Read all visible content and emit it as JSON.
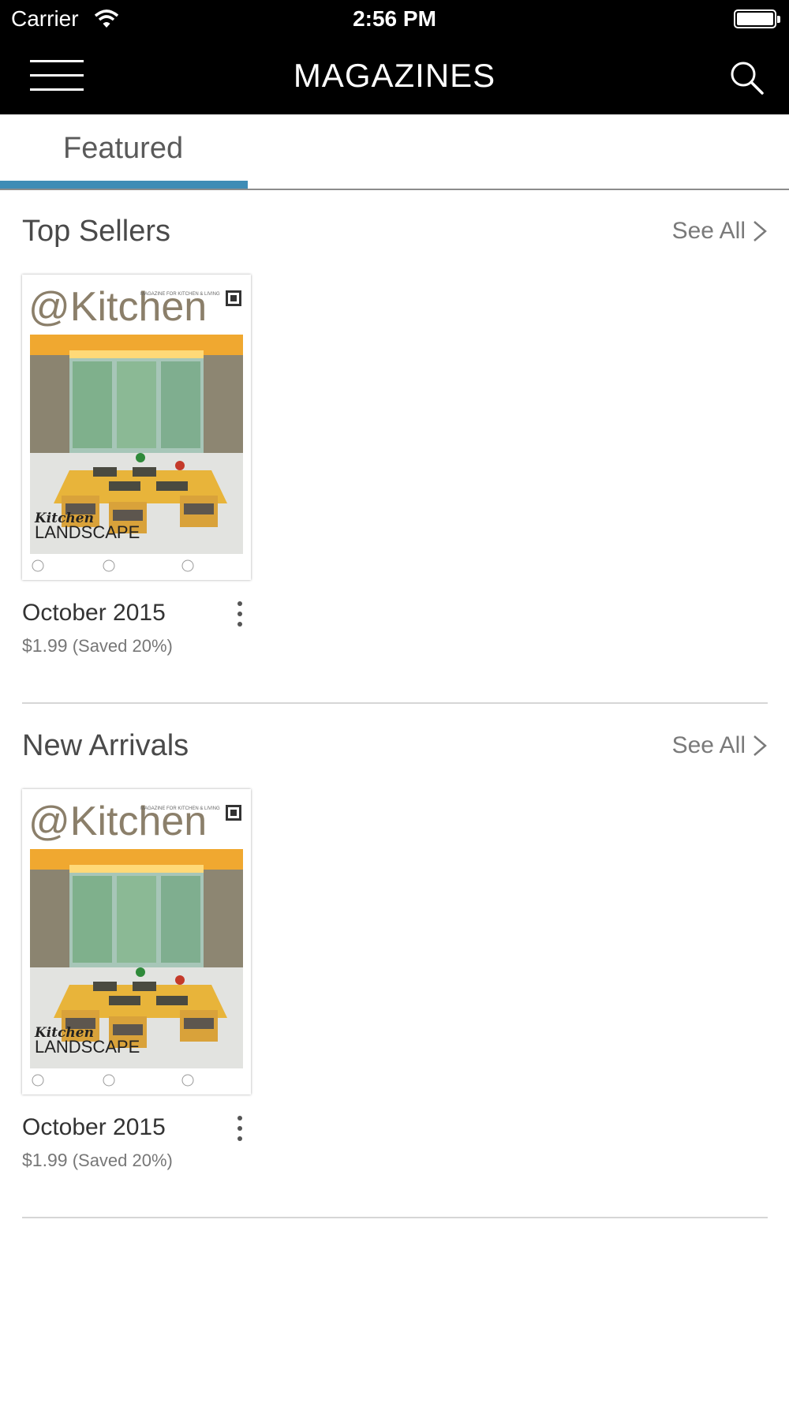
{
  "status_bar": {
    "carrier": "Carrier",
    "time": "2:56 PM"
  },
  "nav": {
    "title": "MAGAZINES"
  },
  "tabs": [
    {
      "label": "Featured",
      "selected": true
    }
  ],
  "colors": {
    "accent": "#3f8cb5",
    "nav_bg": "#000000"
  },
  "sections": [
    {
      "title": "Top Sellers",
      "see_all": "See All",
      "items": [
        {
          "title": "October 2015",
          "price": "$1.99",
          "saving": "(Saved 20%)",
          "cover": {
            "masthead": "@Kitchen",
            "tagline": "MAGAZINE FOR KITCHEN & LIVING",
            "headline_1": "Kitchen",
            "headline_2": "LANDSCAPE"
          }
        }
      ]
    },
    {
      "title": "New Arrivals",
      "see_all": "See All",
      "items": [
        {
          "title": "October 2015",
          "price": "$1.99",
          "saving": "(Saved 20%)",
          "cover": {
            "masthead": "@Kitchen",
            "tagline": "MAGAZINE FOR KITCHEN & LIVING",
            "headline_1": "Kitchen",
            "headline_2": "LANDSCAPE"
          }
        }
      ]
    }
  ]
}
